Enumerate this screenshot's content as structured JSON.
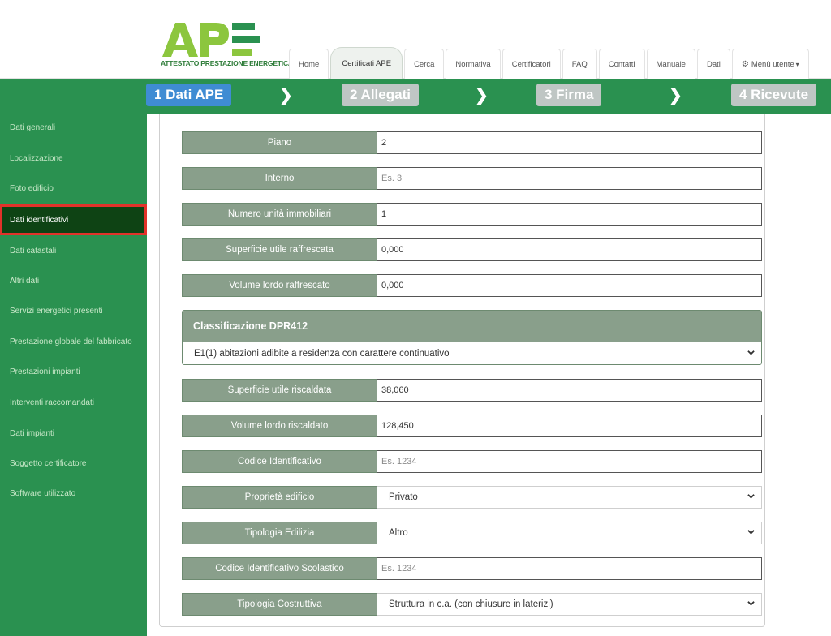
{
  "brand": {
    "logo_text": "APE",
    "logo_sub": "ATTESTATO PRESTAZIONE ENERGETICA",
    "colors": {
      "green": "#2a9150",
      "dark_green": "#0e4314",
      "blue": "#3f8cd3",
      "label_bg": "#899f8b",
      "highlight": "#e2322a"
    }
  },
  "nav": {
    "tabs": [
      {
        "label": "Home"
      },
      {
        "label": "Certificati APE",
        "active": true
      },
      {
        "label": "Cerca"
      },
      {
        "label": "Normativa"
      },
      {
        "label": "Certificatori"
      },
      {
        "label": "FAQ"
      },
      {
        "label": "Contatti"
      },
      {
        "label": "Manuale"
      },
      {
        "label": "Dati"
      },
      {
        "label": "Menù utente",
        "icon": "gear-icon"
      }
    ]
  },
  "steps": [
    {
      "label": "1 Dati APE",
      "active": true
    },
    {
      "label": "2 Allegati"
    },
    {
      "label": "3 Firma"
    },
    {
      "label": "4 Ricevute"
    }
  ],
  "sidebar": {
    "items": [
      {
        "label": "Dati generali"
      },
      {
        "label": "Localizzazione"
      },
      {
        "label": "Foto edificio"
      },
      {
        "label": "Dati identificativi",
        "active": true
      },
      {
        "label": "Dati catastali"
      },
      {
        "label": "Altri dati"
      },
      {
        "label": "Servizi energetici presenti"
      },
      {
        "label": "Prestazione globale del fabbricato"
      },
      {
        "label": "Prestazioni impianti"
      },
      {
        "label": "Interventi raccomandati"
      },
      {
        "label": "Dati impianti"
      },
      {
        "label": "Soggetto certificatore"
      },
      {
        "label": "Software utilizzato"
      }
    ]
  },
  "form": {
    "piano": {
      "label": "Piano",
      "value": "2"
    },
    "interno": {
      "label": "Interno",
      "placeholder": "Es. 3"
    },
    "numero_unita": {
      "label": "Numero unità immobiliari",
      "value": "1"
    },
    "sup_raffrescata": {
      "label": "Superficie utile raffrescata",
      "value": "0,000"
    },
    "vol_raffrescato": {
      "label": "Volume lordo raffrescato",
      "value": "0,000"
    },
    "classificazione": {
      "label": "Classificazione DPR412",
      "selected": "E1(1) abitazioni adibite a residenza con carattere continuativo"
    },
    "sup_riscaldata": {
      "label": "Superficie utile riscaldata",
      "value": "38,060"
    },
    "vol_riscaldato": {
      "label": "Volume lordo riscaldato",
      "value": "128,450"
    },
    "codice_id": {
      "label": "Codice Identificativo",
      "placeholder": "Es. 1234"
    },
    "proprieta": {
      "label": "Proprietà edificio",
      "selected": "Privato"
    },
    "tipologia_edilizia": {
      "label": "Tipologia Edilizia",
      "selected": "Altro"
    },
    "codice_scolastico": {
      "label": "Codice Identificativo Scolastico",
      "placeholder": "Es. 1234"
    },
    "tipologia_costruttiva": {
      "label": "Tipologia Costruttiva",
      "selected": "Struttura in c.a. (con chiusure in laterizi)"
    }
  }
}
